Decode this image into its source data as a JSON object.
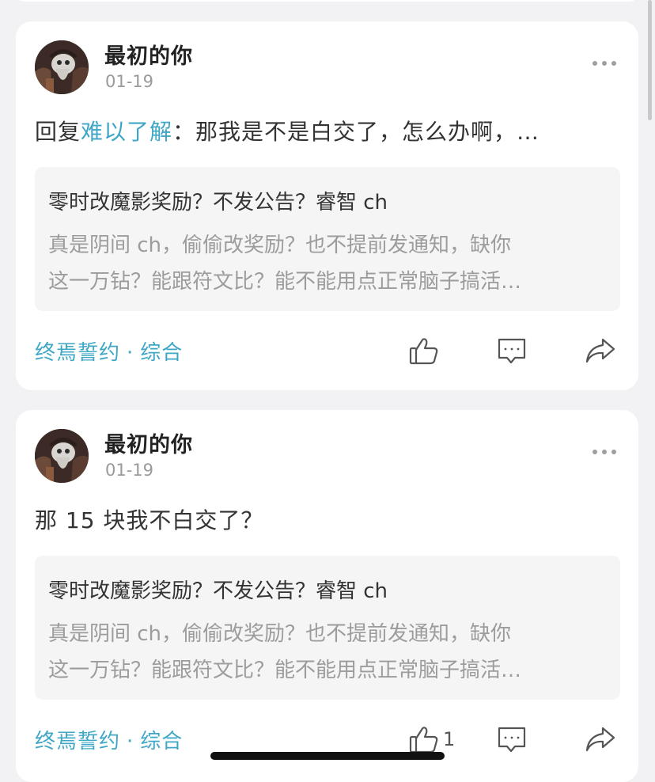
{
  "feed": {
    "posts": [
      {
        "username": "最初的你",
        "date": "01-19",
        "reply_prefix": "回复",
        "mention": "难以了解",
        "content_text": "：那我是不是白交了，怎么办啊，…",
        "quote": {
          "title": "零时改魔影奖励？不发公告？睿智 ch",
          "line1": "真是阴间 ch，偷偷改奖励？也不提前发通知，缺你",
          "line2": "这一万钻？能跟符文比？能不能用点正常脑子搞活…"
        },
        "topic_author": "终焉誓约",
        "topic_separator": "·",
        "topic_category": "综合",
        "like_count": ""
      },
      {
        "username": "最初的你",
        "date": "01-19",
        "reply_prefix": "",
        "mention": "",
        "content_text": "那 15 块我不白交了？",
        "quote": {
          "title": "零时改魔影奖励？不发公告？睿智 ch",
          "line1": "真是阴间 ch，偷偷改奖励？也不提前发通知，缺你",
          "line2": "这一万钻？能跟符文比？能不能用点正常脑子搞活…"
        },
        "topic_author": "终焉誓约",
        "topic_separator": "·",
        "topic_category": "综合",
        "like_count": "1"
      }
    ]
  },
  "icons": {
    "more": "more-horizontal-icon",
    "like": "thumbs-up-icon",
    "comment": "comment-icon",
    "share": "share-icon"
  },
  "colors": {
    "accent": "#3fa7c6",
    "background": "#f2f2f4",
    "card": "#ffffff",
    "quote_bg": "#f5f5f6"
  }
}
